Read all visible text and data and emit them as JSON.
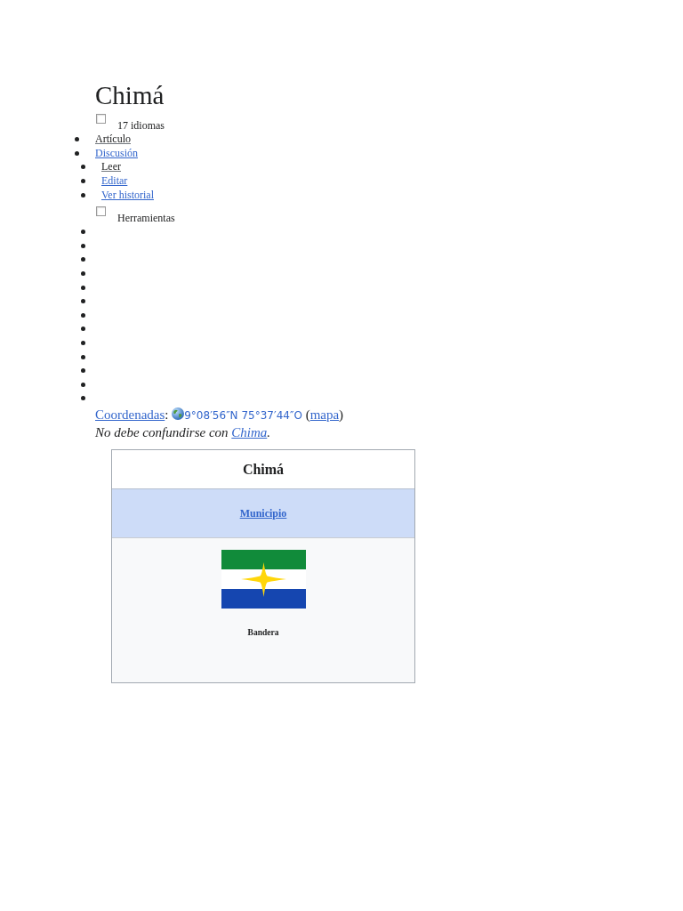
{
  "page": {
    "title": "Chimá"
  },
  "languages": {
    "checked": false,
    "label": "17 idiomas"
  },
  "namespaces": [
    {
      "label": "Artículo",
      "selected": true
    },
    {
      "label": "Discusión",
      "selected": false
    }
  ],
  "views": [
    {
      "label": "Leer",
      "selected": true
    },
    {
      "label": "Editar",
      "selected": false
    },
    {
      "label": "Ver historial",
      "selected": false
    }
  ],
  "tools": {
    "checked": false,
    "label": "Herramientas"
  },
  "empty_list_items": [
    {
      "kind": "bullet"
    },
    {
      "kind": "bullet"
    },
    {
      "kind": "bullet"
    },
    {
      "kind": "bullet"
    },
    {
      "kind": "bullet"
    },
    {
      "kind": "bullet"
    },
    {
      "kind": "bullet"
    },
    {
      "kind": "bullet"
    },
    {
      "kind": "bullet"
    },
    {
      "kind": "bullet"
    },
    {
      "kind": "bullet"
    },
    {
      "kind": "bullet"
    },
    {
      "kind": "bullet"
    }
  ],
  "coordinates": {
    "label": "Coordenadas",
    "colon": ":",
    "value": "9°08′56″N 75°37′44″O",
    "paren_open": "(",
    "map_link": "mapa",
    "paren_close": ")"
  },
  "hatnote": {
    "text": "No debe confundirse con",
    "link": "Chima",
    "end": "."
  },
  "infobox": {
    "title": "Chimá",
    "subheader": "Municipio",
    "image_caption": "Bandera"
  }
}
